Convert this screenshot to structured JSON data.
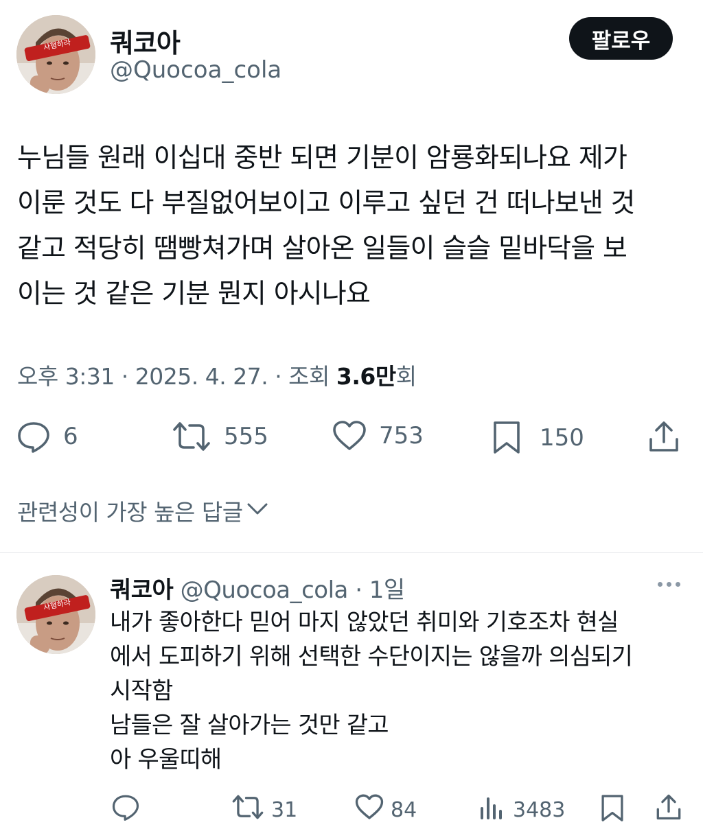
{
  "tweet": {
    "author_name": "쿼코아",
    "author_handle": "@Quocoa_cola",
    "avatar_badge_text": "사형하라",
    "follow_label": "팔로우",
    "text_lines": [
      "누님들 원래 이십대 중반 되면 기분이 암룡화되나요 제가",
      "이룬 것도 다 부질없어보이고 이루고 싶던 건 떠나보낸 것",
      "같고 적당히 땜빵쳐가며 살아온 일들이 슬슬 밑바닥을 보",
      "이는 것 같은 기분 뭔지 아시나요"
    ],
    "meta_prefix": "오후 3:31 · 2025. 4. 27. · 조회 ",
    "views_value": "3.6만",
    "views_suffix": "회",
    "actions": {
      "replies": "6",
      "retweets": "555",
      "likes": "753",
      "bookmarks": "150"
    },
    "icons": [
      "reply-icon",
      "retweet-icon",
      "like-icon",
      "bookmark-icon",
      "share-icon"
    ]
  },
  "sort_label": "관련성이 가장 높은 답글",
  "reply": {
    "author_name": "쿼코아",
    "author_handle": "@Quocoa_cola",
    "time": "· 1일",
    "text_lines": [
      "내가 좋아한다 믿어 마지 않았던 취미와 기호조차 현실",
      "에서 도피하기 위해 선택한 수단이지는 않을까 의심되기",
      "시작함",
      "남들은 잘 살아가는 것만 같고",
      "아 우울띠해"
    ],
    "actions": {
      "retweets": "31",
      "likes": "84",
      "views": "3483"
    },
    "icons": [
      "reply-icon",
      "retweet-icon",
      "like-icon",
      "views-icon",
      "bookmark-icon",
      "share-icon"
    ]
  },
  "colors": {
    "text": "#0f1419",
    "muted": "#536471",
    "follow_bg": "#0f1419",
    "badge_red": "#c0201e"
  }
}
